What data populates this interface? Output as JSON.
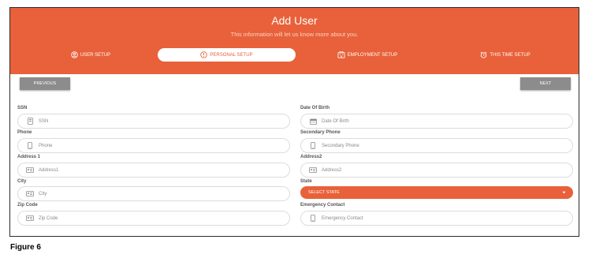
{
  "header": {
    "title": "Add User",
    "subtitle": "This information will let us know more about you.",
    "steps": [
      {
        "label": "USER SETUP",
        "icon": "user-circle-icon"
      },
      {
        "label": "PERSONAL SETUP",
        "icon": "info-circle-icon"
      },
      {
        "label": "EMPLOYMENT SETUP",
        "icon": "building-icon"
      },
      {
        "label": "THIS TIME SETUP",
        "icon": "alarm-clock-icon"
      }
    ],
    "active_step": 1,
    "accent_color": "#e8613a"
  },
  "nav": {
    "previous_label": "PREVIOUS",
    "next_label": "NEXT"
  },
  "form": {
    "left": [
      {
        "label": "SSN",
        "placeholder": "SSN",
        "icon": "id-card-icon"
      },
      {
        "label": "Phone",
        "placeholder": "Phone",
        "icon": "phone-icon"
      },
      {
        "label": "Address 1",
        "placeholder": "Address1",
        "icon": "address-card-icon"
      },
      {
        "label": "City",
        "placeholder": "City",
        "icon": "address-card-icon"
      },
      {
        "label": "Zip Code",
        "placeholder": "Zip Code",
        "icon": "address-card-icon"
      }
    ],
    "right": [
      {
        "label": "Date Of Birth",
        "placeholder": "Date Of Birth",
        "icon": "calendar-icon"
      },
      {
        "label": "Secondary Phone",
        "placeholder": "Secondary Phone",
        "icon": "phone-icon"
      },
      {
        "label": "Address2",
        "placeholder": "Address2",
        "icon": "address-card-icon"
      },
      {
        "label": "State",
        "select_value": "SELECT STATE",
        "icon": "caret-down-icon"
      },
      {
        "label": "Emergency Contact",
        "placeholder": "Emergency Contact",
        "icon": "phone-icon"
      }
    ]
  },
  "caption": "Figure 6"
}
